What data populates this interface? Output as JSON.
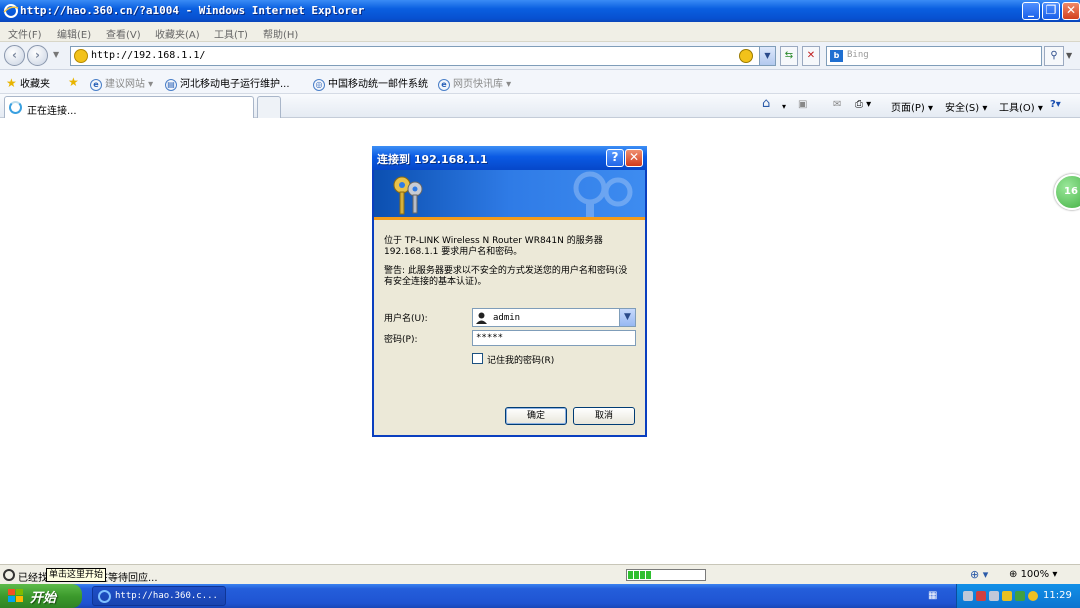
{
  "window": {
    "title": "http://hao.360.cn/?a1004 - Windows Internet Explorer"
  },
  "menu": [
    "文件(F)",
    "编辑(E)",
    "查看(V)",
    "收藏夹(A)",
    "工具(T)",
    "帮助(H)"
  ],
  "address": {
    "url": "http://192.168.1.1/",
    "search_placeholder": "Bing"
  },
  "favorites": {
    "label": "收藏夹",
    "items": [
      "建议网站 ▾",
      "河北移动电子运行维护...",
      "中国移动统一邮件系统",
      "网页快讯库 ▾"
    ]
  },
  "tab": {
    "label": "正在连接..."
  },
  "commands": {
    "page": "页面(P) ▾",
    "safety": "安全(S) ▾",
    "tools": "工具(O) ▾",
    "help": "?▾"
  },
  "side_badge": "16",
  "dialog": {
    "title": "连接到 192.168.1.1",
    "message": "位于 TP-LINK Wireless N Router WR841N 的服务器 192.168.1.1 要求用户名和密码。",
    "warning": "警告: 此服务器要求以不安全的方式发送您的用户名和密码(没有安全连接的基本认证)。",
    "username_label": "用户名(U):",
    "username_value": "admin",
    "password_label": "密码(P):",
    "password_value": "*****",
    "remember_label": "记住我的密码(R)",
    "remember_checked": false,
    "ok": "确定",
    "cancel": "取消"
  },
  "status": {
    "text": "已经找到站点，正在等待回应...",
    "tooltip": "单击这里开始",
    "progress_segments": 4,
    "zoom": "100%"
  },
  "taskbar": {
    "start": "开始",
    "task": "http://hao.360.c...",
    "clock": "11:29"
  }
}
